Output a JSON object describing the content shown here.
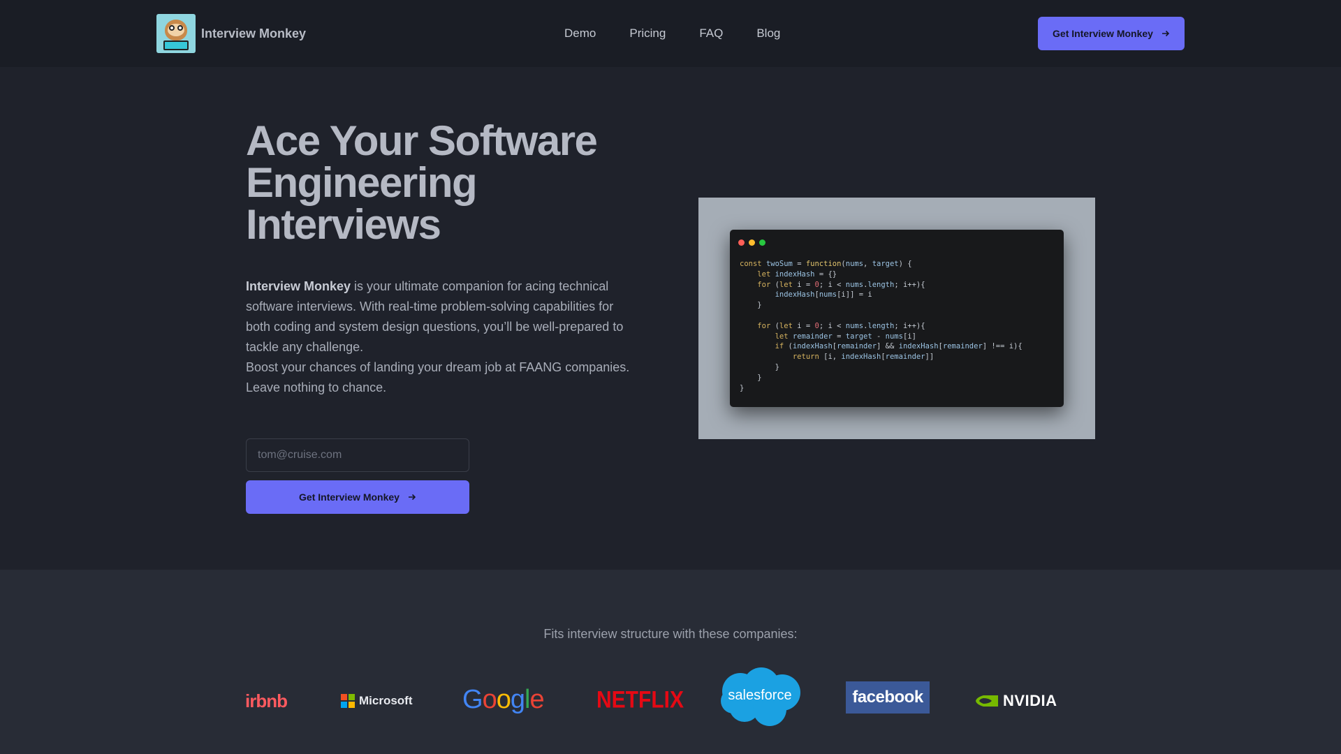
{
  "brand": {
    "name": "Interview Monkey",
    "logo_icon": "monkey-laptop-icon"
  },
  "nav": {
    "links": [
      "Demo",
      "Pricing",
      "FAQ",
      "Blog"
    ],
    "cta_label": "Get Interview Monkey",
    "cta_icon": "arrow-right-icon"
  },
  "hero": {
    "title_lines": [
      "Ace Your Software",
      "Engineering",
      "Interviews"
    ],
    "desc_brand": "Interview Monkey",
    "desc_text": " is your ultimate companion for acing technical software interviews. With real-time problem-solving capabilities for both coding and system design questions, you’ll be well-prepared to tackle any challenge.",
    "desc_text2": "Boost your chances of landing your dream job at FAANG companies. Leave nothing to chance.",
    "email_placeholder": "tom@cruise.com",
    "cta_label": "Get Interview Monkey"
  },
  "code_preview": {
    "window_dots": [
      "#ff5f57",
      "#febc2e",
      "#28c840"
    ],
    "lines": [
      "const twoSum = function(nums, target) {",
      "    let indexHash = {}",
      "    for (let i = 0; i < nums.length; i++){",
      "        indexHash[nums[i]] = i",
      "    }",
      "",
      "    for (let i = 0; i < nums.length; i++){",
      "        let remainder = target - nums[i]",
      "        if (indexHash[remainder] && indexHash[remainder] !== i){",
      "            return [i, indexHash[remainder]]",
      "        }",
      "    }",
      "}"
    ]
  },
  "companies": {
    "label": "Fits interview structure with these companies:",
    "logos": [
      "irbnb",
      "Microsoft",
      "Google",
      "NETFLIX",
      "salesforce",
      "facebook",
      "NVIDIA"
    ]
  },
  "colors": {
    "accent": "#6a6cf6",
    "background": "#1f222b",
    "nav_bg": "#1a1d25",
    "companies_bg": "#282c36"
  }
}
